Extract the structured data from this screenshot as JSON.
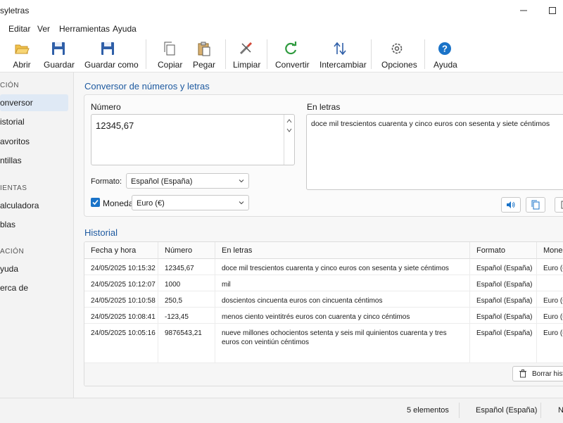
{
  "window": {
    "title": "syletras"
  },
  "menu": [
    "Editar",
    "Ver",
    "Herramientas",
    "Ayuda"
  ],
  "toolbar": {
    "open": "Abrir",
    "save": "Guardar",
    "save_as": "Guardar como",
    "copy": "Copiar",
    "paste": "Pegar",
    "clear": "Limpiar",
    "convert": "Convertir",
    "swap": "Intercambiar",
    "options": "Opciones",
    "help": "Ayuda"
  },
  "sidebar": {
    "section1": "CIÓN",
    "items1": [
      "onversor",
      "istorial",
      "avoritos",
      "ntillas"
    ],
    "section2": "IENTAS",
    "items2": [
      "alculadora",
      "blas"
    ],
    "section3": "ACIÓN",
    "items3": [
      "yuda",
      "erca de"
    ]
  },
  "converter": {
    "title": "Conversor de números y letras",
    "number_label": "Número",
    "number_value": "12345,67",
    "letters_label": "En letras",
    "letters_value": "doce mil trescientos cuarenta y cinco euros con sesenta y siete céntimos",
    "format_label": "Formato:",
    "format_value": "Español (España)",
    "currency_label": "Moneda",
    "currency_checked": true,
    "currency_value": "Euro (€)"
  },
  "history": {
    "title": "Historial",
    "columns": [
      "Fecha y hora",
      "Número",
      "En letras",
      "Formato",
      "Moned"
    ],
    "rows": [
      [
        "24/05/2025 10:15:32",
        "12345,67",
        "doce mil trescientos cuarenta y cinco euros con sesenta y siete céntimos",
        "Español (España)",
        "Euro (€"
      ],
      [
        "24/05/2025 10:12:07",
        "1000",
        "mil",
        "Español (España)",
        ""
      ],
      [
        "24/05/2025 10:10:58",
        "250,5",
        "doscientos cincuenta euros con cincuenta céntimos",
        "Español (España)",
        "Euro (€"
      ],
      [
        "24/05/2025 10:08:41",
        "-123,45",
        "menos ciento veintitrés euros con cuarenta y cinco céntimos",
        "Español (España)",
        "Euro (€"
      ],
      [
        "24/05/2025 10:05:16",
        "9876543,21",
        "nueve millones ochocientos setenta y seis mil quinientos cuarenta y tres euros con veintiún céntimos",
        "Español (España)",
        "Euro (€"
      ]
    ],
    "clear_button": "Borrar histo"
  },
  "status": {
    "count": "5 elementos",
    "format": "Español (España)",
    "extra": "N"
  },
  "colors": {
    "accent": "#1e5aa0",
    "check": "#1a73c8"
  }
}
